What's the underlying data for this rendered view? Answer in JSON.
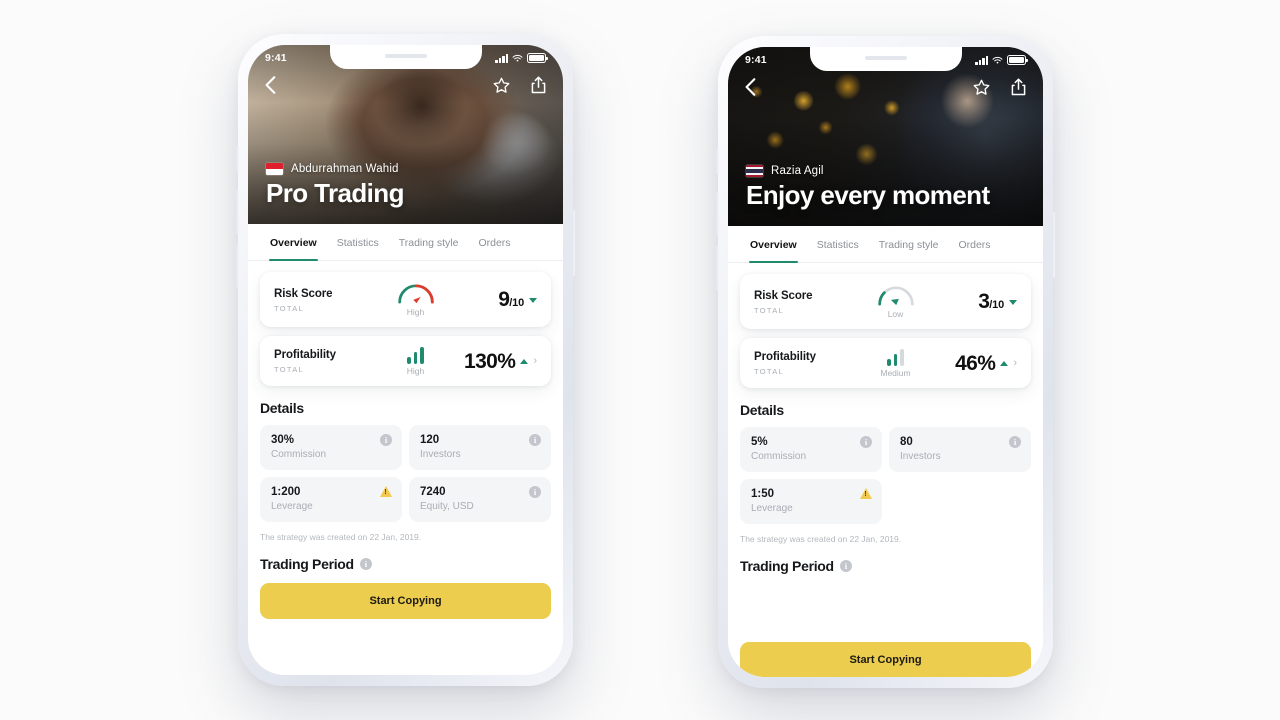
{
  "app": {
    "background_color": "#fbfbfb",
    "accent_green": "#1f8a6d",
    "cta_color": "#eccd4e"
  },
  "phones": [
    {
      "id": "phone-left",
      "status_bar": {
        "time": "9:41",
        "signal_icon": "cellular-bars-icon",
        "wifi_icon": "wifi-icon",
        "battery_icon": "battery-icon"
      },
      "hero": {
        "back_icon": "back-chevron-icon",
        "favorite_icon": "star-icon",
        "share_icon": "share-icon",
        "flag": "indonesia-flag",
        "trader_name": "Abdurrahman Wahid",
        "title": "Pro Trading"
      },
      "tabs": [
        {
          "label": "Overview",
          "active": true
        },
        {
          "label": "Statistics",
          "active": false
        },
        {
          "label": "Trading style",
          "active": false
        },
        {
          "label": "Orders",
          "active": false
        }
      ],
      "metrics": [
        {
          "name": "risk-score",
          "title": "Risk Score",
          "subtitle": "TOTAL",
          "gauge_label": "High",
          "gauge_level": "high",
          "value": "9",
          "denominator": "/10",
          "trend": "down"
        },
        {
          "name": "profitability",
          "title": "Profitability",
          "subtitle": "TOTAL",
          "gauge_label": "High",
          "bars_on": 3,
          "value": "130%",
          "trend": "up",
          "chevron": "›"
        }
      ],
      "details": {
        "heading": "Details",
        "cards": [
          {
            "value": "30%",
            "label": "Commission",
            "badge": "info"
          },
          {
            "value": "120",
            "label": "Investors",
            "badge": "info"
          },
          {
            "value": "1:200",
            "label": "Leverage",
            "badge": "warning"
          },
          {
            "value": "7240",
            "label": "Equity, USD",
            "badge": "info"
          }
        ],
        "note": "The strategy was created on 22 Jan, 2019."
      },
      "trading_period": {
        "heading": "Trading Period",
        "info_icon": "info-icon"
      },
      "cta": {
        "label": "Start Copying"
      }
    },
    {
      "id": "phone-right",
      "status_bar": {
        "time": "9:41",
        "signal_icon": "cellular-bars-icon",
        "wifi_icon": "wifi-icon",
        "battery_icon": "battery-icon"
      },
      "hero": {
        "back_icon": "back-chevron-icon",
        "favorite_icon": "star-icon",
        "share_icon": "share-icon",
        "flag": "thailand-flag",
        "trader_name": "Razia Agil",
        "title": "Enjoy every moment"
      },
      "tabs": [
        {
          "label": "Overview",
          "active": true
        },
        {
          "label": "Statistics",
          "active": false
        },
        {
          "label": "Trading style",
          "active": false
        },
        {
          "label": "Orders",
          "active": false
        }
      ],
      "metrics": [
        {
          "name": "risk-score",
          "title": "Risk Score",
          "subtitle": "TOTAL",
          "gauge_label": "Low",
          "gauge_level": "low",
          "value": "3",
          "denominator": "/10",
          "trend": "down"
        },
        {
          "name": "profitability",
          "title": "Profitability",
          "subtitle": "TOTAL",
          "gauge_label": "Medium",
          "bars_on": 2,
          "value": "46%",
          "trend": "up",
          "chevron": "›"
        }
      ],
      "details": {
        "heading": "Details",
        "cards": [
          {
            "value": "5%",
            "label": "Commission",
            "badge": "info"
          },
          {
            "value": "80",
            "label": "Investors",
            "badge": "info"
          },
          {
            "value": "1:50",
            "label": "Leverage",
            "badge": "warning"
          }
        ],
        "note": "The strategy was created on 22 Jan, 2019."
      },
      "trading_period": {
        "heading": "Trading Period",
        "info_icon": "info-icon"
      },
      "cta": {
        "label": "Start Copying"
      }
    }
  ]
}
